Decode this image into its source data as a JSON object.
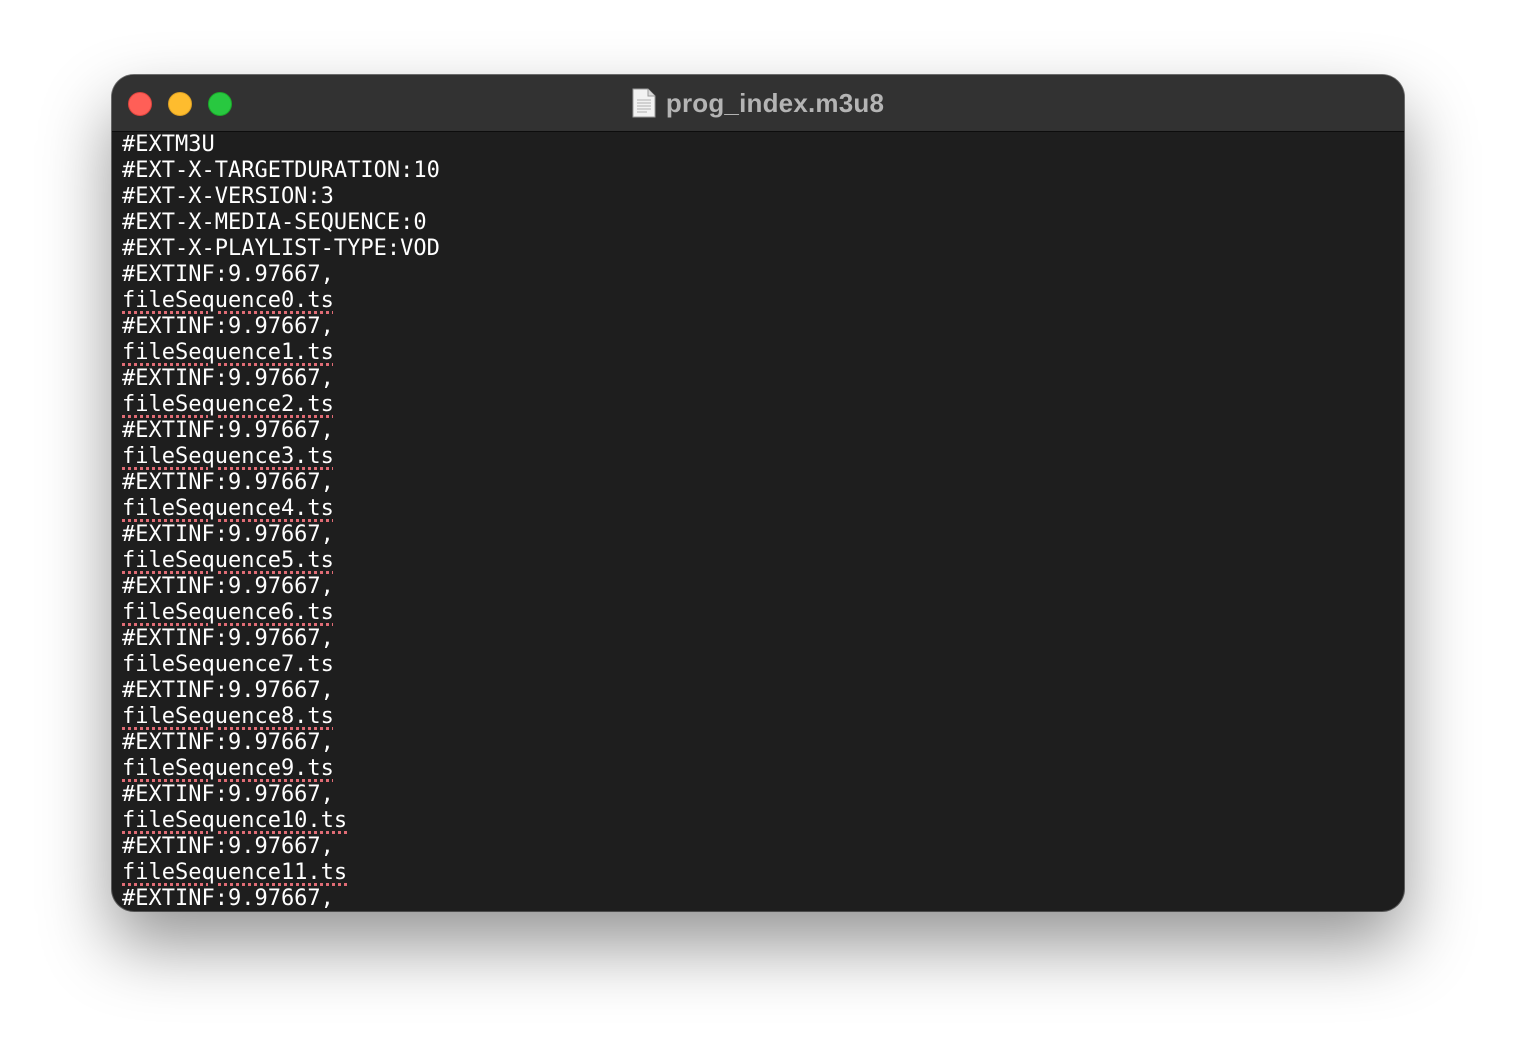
{
  "window": {
    "title": "prog_index.m3u8",
    "icon": "document-icon"
  },
  "buttons": {
    "close": "close-button",
    "minimize": "minimize-button",
    "zoom": "zoom-button"
  },
  "colors": {
    "background": "#1e1e1e",
    "titlebar": "#323232",
    "text": "#ffffff",
    "spellcheck_underline": "#e06c75",
    "close": "#ff5f57",
    "minimize": "#febc2e",
    "zoom": "#28c840"
  },
  "lines": [
    {
      "text": "#EXTM3U",
      "misspelled": false
    },
    {
      "text": "#EXT-X-TARGETDURATION:10",
      "misspelled": false
    },
    {
      "text": "#EXT-X-VERSION:3",
      "misspelled": false
    },
    {
      "text": "#EXT-X-MEDIA-SEQUENCE:0",
      "misspelled": false
    },
    {
      "text": "#EXT-X-PLAYLIST-TYPE:VOD",
      "misspelled": false
    },
    {
      "text": "#EXTINF:9.97667,",
      "misspelled": false
    },
    {
      "text": "fileSequence0.ts",
      "misspelled": true
    },
    {
      "text": "#EXTINF:9.97667,",
      "misspelled": false
    },
    {
      "text": "fileSequence1.ts",
      "misspelled": true
    },
    {
      "text": "#EXTINF:9.97667,",
      "misspelled": false
    },
    {
      "text": "fileSequence2.ts",
      "misspelled": true
    },
    {
      "text": "#EXTINF:9.97667,",
      "misspelled": false
    },
    {
      "text": "fileSequence3.ts",
      "misspelled": true
    },
    {
      "text": "#EXTINF:9.97667,",
      "misspelled": false
    },
    {
      "text": "fileSequence4.ts",
      "misspelled": true
    },
    {
      "text": "#EXTINF:9.97667,",
      "misspelled": false
    },
    {
      "text": "fileSequence5.ts",
      "misspelled": true
    },
    {
      "text": "#EXTINF:9.97667,",
      "misspelled": false
    },
    {
      "text": "fileSequence6.ts",
      "misspelled": true
    },
    {
      "text": "#EXTINF:9.97667,",
      "misspelled": false
    },
    {
      "text": "fileSequence7.ts",
      "misspelled": false
    },
    {
      "text": "#EXTINF:9.97667,",
      "misspelled": false
    },
    {
      "text": "fileSequence8.ts",
      "misspelled": true
    },
    {
      "text": "#EXTINF:9.97667,",
      "misspelled": false
    },
    {
      "text": "fileSequence9.ts",
      "misspelled": true
    },
    {
      "text": "#EXTINF:9.97667,",
      "misspelled": false
    },
    {
      "text": "fileSequence10.ts",
      "misspelled": true
    },
    {
      "text": "#EXTINF:9.97667,",
      "misspelled": false
    },
    {
      "text": "fileSequence11.ts",
      "misspelled": true
    },
    {
      "text": "#EXTINF:9.97667,",
      "misspelled": false
    }
  ]
}
